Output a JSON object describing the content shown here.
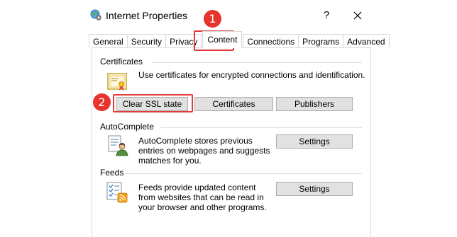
{
  "window": {
    "title": "Internet Properties",
    "help_label": "?"
  },
  "tabs": [
    {
      "label": "General"
    },
    {
      "label": "Security"
    },
    {
      "label": "Privacy"
    },
    {
      "label": "Content",
      "active": true
    },
    {
      "label": "Connections"
    },
    {
      "label": "Programs"
    },
    {
      "label": "Advanced"
    }
  ],
  "certificates": {
    "group_label": "Certificates",
    "description": "Use certificates for encrypted connections and identification.",
    "clear_ssl_button": "Clear SSL state",
    "certificates_button": "Certificates",
    "publishers_button": "Publishers"
  },
  "autocomplete": {
    "group_label": "AutoComplete",
    "description": "AutoComplete stores previous entries on webpages and suggests matches for you.",
    "settings_button": "Settings"
  },
  "feeds": {
    "group_label": "Feeds",
    "description": "Feeds provide updated content from websites that can be read in your browser and other programs.",
    "settings_button": "Settings"
  },
  "callouts": {
    "step1": "1",
    "step2": "2"
  },
  "colors": {
    "highlight": "#e53a3a",
    "callout": "#e8322e",
    "button_face": "#e1e1e1"
  },
  "icons": {
    "app": "globe-gear-icon",
    "certificates": "certificate-icon",
    "autocomplete": "autocomplete-user-icon",
    "feeds": "feeds-rss-icon",
    "close": "close-icon"
  }
}
